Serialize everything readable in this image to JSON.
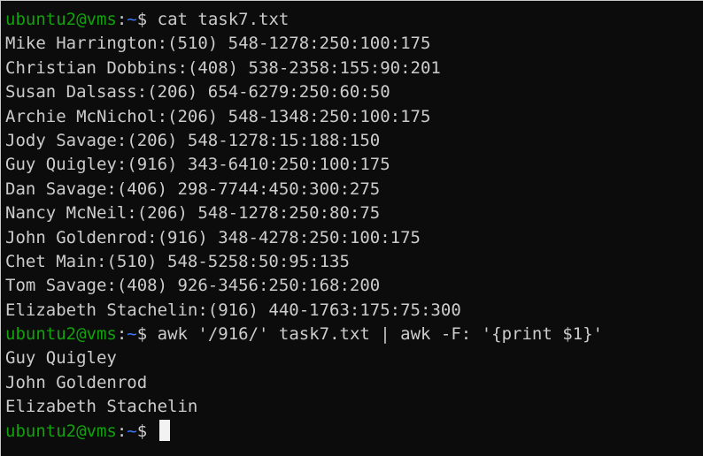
{
  "prompt": {
    "userhost": "ubuntu2@vms",
    "sep": ":",
    "path": "~",
    "symbol": "$ "
  },
  "commands": [
    "cat task7.txt",
    "awk '/916/' task7.txt | awk -F: '{print $1}'",
    ""
  ],
  "output1": [
    "Mike Harrington:(510) 548-1278:250:100:175",
    "Christian Dobbins:(408) 538-2358:155:90:201",
    "Susan Dalsass:(206) 654-6279:250:60:50",
    "Archie McNichol:(206) 548-1348:250:100:175",
    "Jody Savage:(206) 548-1278:15:188:150",
    "Guy Quigley:(916) 343-6410:250:100:175",
    "Dan Savage:(406) 298-7744:450:300:275",
    "Nancy McNeil:(206) 548-1278:250:80:75",
    "John Goldenrod:(916) 348-4278:250:100:175",
    "Chet Main:(510) 548-5258:50:95:135",
    "Tom Savage:(408) 926-3456:250:168:200",
    "Elizabeth Stachelin:(916) 440-1763:175:75:300"
  ],
  "output2": [
    "Guy Quigley",
    "John Goldenrod",
    "Elizabeth Stachelin"
  ],
  "colors": {
    "background": "#0c0c0c",
    "text": "#cccccc",
    "user": "#13a10e",
    "path": "#3b78ff"
  }
}
